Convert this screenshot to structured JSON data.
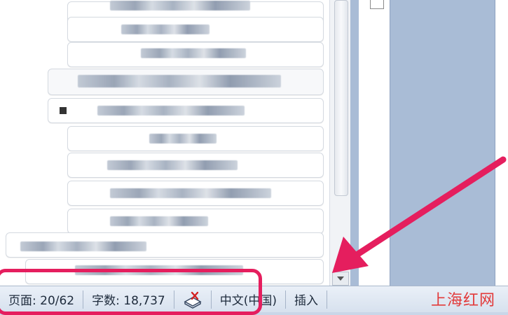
{
  "status_bar": {
    "page": "页面: 20/62",
    "word_count": "字数: 18,737",
    "proofing_icon": "proofing-book-icon",
    "language": "中文(中国)",
    "insert_mode": "插入"
  },
  "watermark": {
    "text": "上海红网"
  },
  "colors": {
    "annotation": "#e51e5e",
    "status_bar_bg": "#dce6f2",
    "doc_background": "#a9bcd6"
  }
}
